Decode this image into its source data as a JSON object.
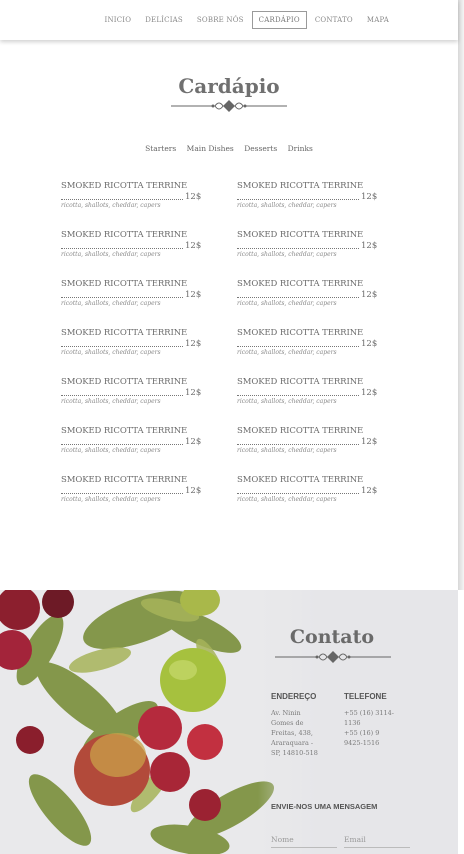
{
  "nav": {
    "items": [
      {
        "label": "INICIO"
      },
      {
        "label": "DELÍCIAS"
      },
      {
        "label": "SOBRE NÓS"
      },
      {
        "label": "CARDÁPIO",
        "active": true
      },
      {
        "label": "CONTATO"
      },
      {
        "label": "MAPA"
      }
    ]
  },
  "menu": {
    "title": "Cardápio",
    "tabs": [
      "Starters",
      "Main Dishes",
      "Desserts",
      "Drinks"
    ],
    "left_items": [
      {
        "name": "SMOKED RICOTTA TERRINE",
        "price": "12$",
        "desc": "ricotta, shallots, cheddar, capers"
      },
      {
        "name": "SMOKED RICOTTA TERRINE",
        "price": "12$",
        "desc": "ricotta, shallots, cheddar, capers"
      },
      {
        "name": "SMOKED RICOTTA TERRINE",
        "price": "12$",
        "desc": "ricotta, shallots, cheddar, capers"
      },
      {
        "name": "SMOKED RICOTTA TERRINE",
        "price": "12$",
        "desc": "ricotta, shallots, cheddar, capers"
      },
      {
        "name": "SMOKED RICOTTA TERRINE",
        "price": "12$",
        "desc": "ricotta, shallots, cheddar, capers"
      },
      {
        "name": "SMOKED RICOTTA TERRINE",
        "price": "12$",
        "desc": "ricotta, shallots, cheddar, capers"
      },
      {
        "name": "SMOKED RICOTTA TERRINE",
        "price": "12$",
        "desc": "ricotta, shallots, cheddar, capers"
      }
    ],
    "right_items": [
      {
        "name": "SMOKED RICOTTA TERRINE",
        "price": "12$",
        "desc": "ricotta, shallots, cheddar, capers"
      },
      {
        "name": "SMOKED RICOTTA TERRINE",
        "price": "12$",
        "desc": "ricotta, shallots, cheddar, capers"
      },
      {
        "name": "SMOKED RICOTTA TERRINE",
        "price": "12$",
        "desc": "ricotta, shallots, cheddar, capers"
      },
      {
        "name": "SMOKED RICOTTA TERRINE",
        "price": "12$",
        "desc": "ricotta, shallots, cheddar, capers"
      },
      {
        "name": "SMOKED RICOTTA TERRINE",
        "price": "12$",
        "desc": "ricotta, shallots, cheddar, capers"
      },
      {
        "name": "SMOKED RICOTTA TERRINE",
        "price": "12$",
        "desc": "ricotta, shallots, cheddar, capers"
      },
      {
        "name": "SMOKED RICOTTA TERRINE",
        "price": "12$",
        "desc": "ricotta, shallots, cheddar, capers"
      }
    ]
  },
  "contact": {
    "title": "Contato",
    "address_heading": "ENDEREÇO",
    "address_lines": [
      "Av. Ninin",
      "Gomes de",
      "Freitas, 438,",
      "Araraquara -",
      "SP, 14810-518"
    ],
    "phone_heading": "TELEFONE",
    "phone_lines": [
      "+55 (16) 3114-",
      "1136",
      "+55 (16) 9",
      "9425-1516"
    ],
    "message_heading": "ENVIE-NOS UMA MENSAGEM",
    "name_placeholder": "Nome",
    "email_placeholder": "Email"
  },
  "icons": {
    "ornament": "ornamental-divider-icon",
    "photo": "fruit-photo"
  },
  "colors": {
    "active_border": "#9a9a9a",
    "text": "#6b6b6b",
    "contact_bg": "#ebebed"
  }
}
